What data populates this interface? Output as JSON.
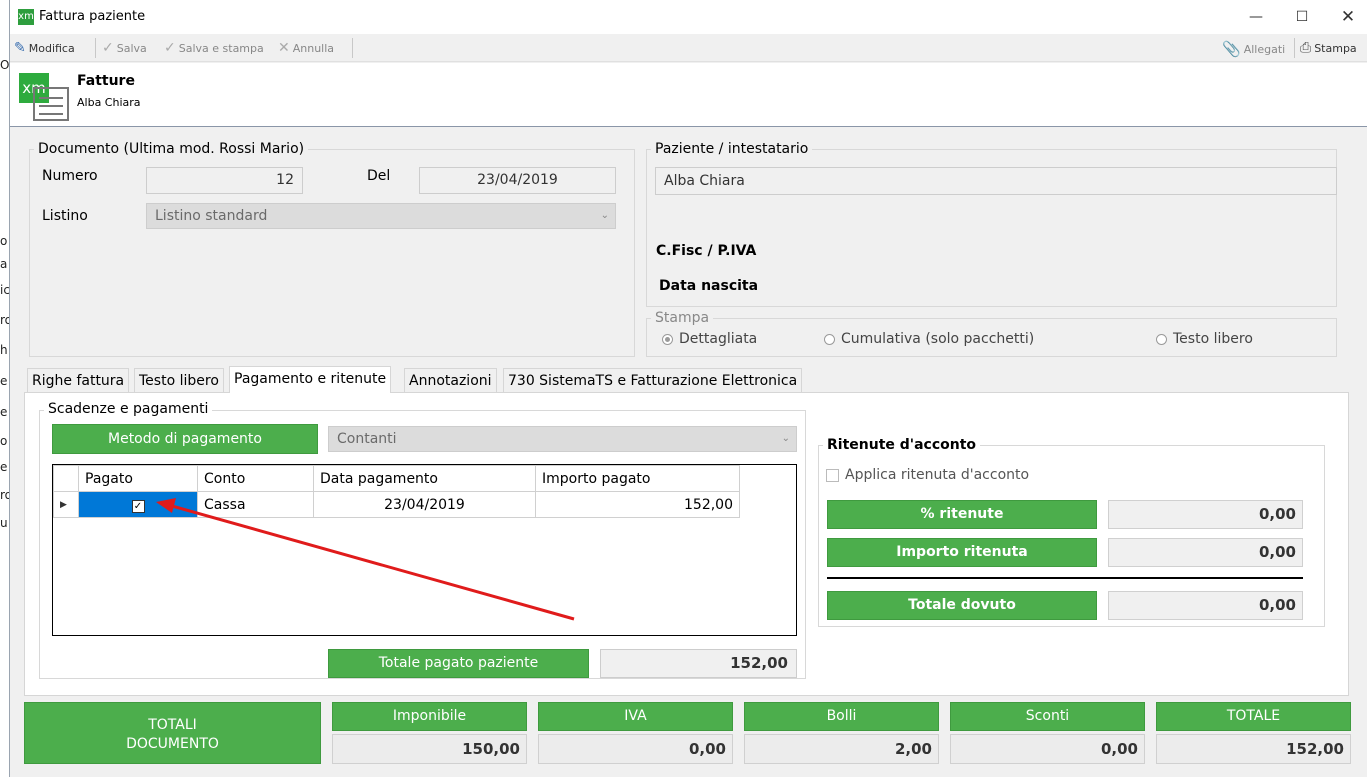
{
  "window": {
    "title": "Fattura paziente"
  },
  "toolbar": {
    "modifica": "Modifica",
    "salva": "Salva",
    "salva_stampa": "Salva e stampa",
    "annulla": "Annulla",
    "allegati": "Allegati",
    "stampa": "Stampa"
  },
  "header": {
    "title": "Fatture",
    "subtitle": "Alba Chiara",
    "logo_text": "xm"
  },
  "documento": {
    "group": "Documento (Ultima mod. Rossi Mario)",
    "numero_label": "Numero",
    "numero": "12",
    "del_label": "Del",
    "del": "23/04/2019",
    "listino_label": "Listino",
    "listino": "Listino standard"
  },
  "paziente": {
    "group": "Paziente / intestatario",
    "name": "Alba Chiara",
    "cf_label": "C.Fisc / P.IVA",
    "nascita_label": "Data nascita"
  },
  "stampa": {
    "group": "Stampa",
    "options": [
      "Dettagliata",
      "Cumulativa (solo pacchetti)",
      "Testo libero"
    ],
    "selected": "Dettagliata"
  },
  "tabs": [
    "Righe fattura",
    "Testo libero",
    "Pagamento e ritenute",
    "Annotazioni",
    "730 SistemaTS e Fatturazione Elettronica"
  ],
  "pagamenti": {
    "group": "Scadenze e pagamenti",
    "metodo_button": "Metodo di pagamento",
    "metodo_value": "Contanti",
    "columns": [
      "Pagato",
      "Conto",
      "Data pagamento",
      "Importo pagato"
    ],
    "rows": [
      {
        "pagato": true,
        "conto": "Cassa",
        "data": "23/04/2019",
        "importo": "152,00"
      }
    ],
    "totale_button": "Totale pagato paziente",
    "totale_value": "152,00"
  },
  "ritenute": {
    "title": "Ritenute d'acconto",
    "checkbox_label": "Applica ritenuta d'acconto",
    "perc_button": "% ritenute",
    "perc_value": "0,00",
    "importo_button": "Importo ritenuta",
    "importo_value": "0,00",
    "totale_button": "Totale dovuto",
    "totale_value": "0,00"
  },
  "totali": {
    "button_line1": "TOTALI",
    "button_line2": "DOCUMENTO",
    "items": [
      {
        "label": "Imponibile",
        "value": "150,00"
      },
      {
        "label": "IVA",
        "value": "0,00"
      },
      {
        "label": "Bolli",
        "value": "2,00"
      },
      {
        "label": "Sconti",
        "value": "0,00"
      },
      {
        "label": "TOTALE",
        "value": "152,00"
      }
    ]
  },
  "colors": {
    "green": "#4cae4c",
    "selection_blue": "#0078d7",
    "arrow_red": "#e01b1b"
  }
}
